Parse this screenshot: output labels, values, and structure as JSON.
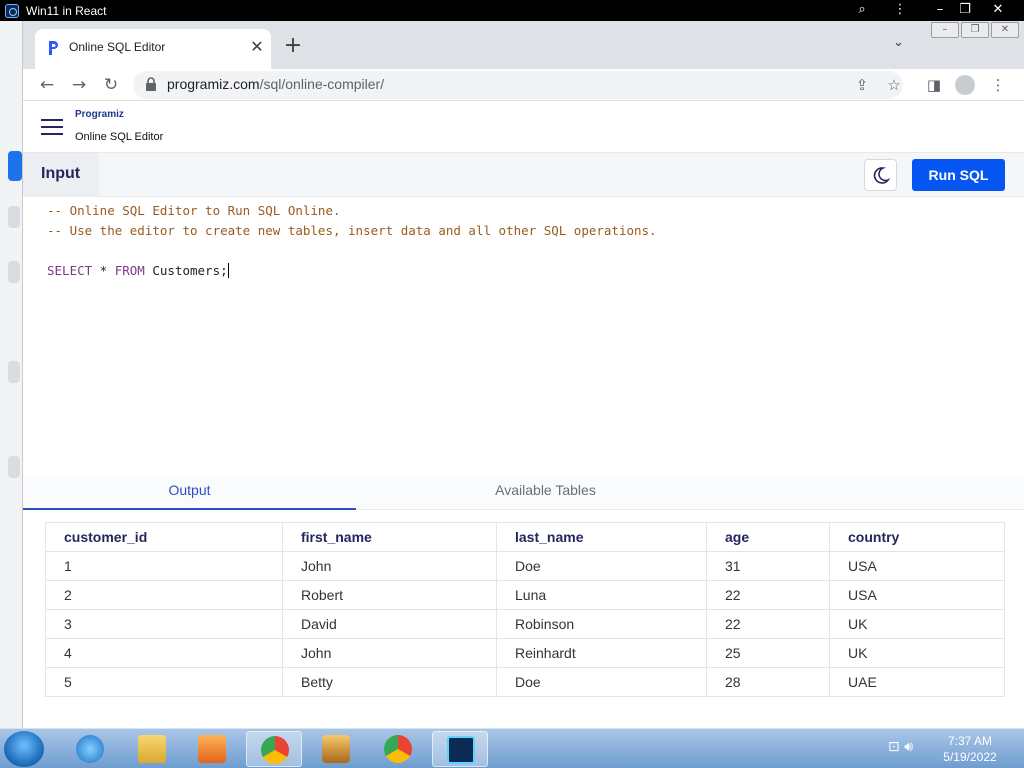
{
  "outer_window": {
    "title": "Win11 in React"
  },
  "chrome": {
    "tab": {
      "title": "Online SQL Editor"
    },
    "address_bar": {
      "host": "programiz.com",
      "path": "/sql/online-compiler/"
    }
  },
  "site": {
    "brand": "Programiz",
    "subtitle": "Online SQL Editor"
  },
  "editor": {
    "input_label": "Input",
    "run_label": "Run SQL",
    "lines": [
      "-- Online SQL Editor to Run SQL Online.",
      "-- Use the editor to create new tables, insert data and all other SQL operations.",
      "",
      "SELECT * FROM Customers;"
    ],
    "query_keyword1": "SELECT",
    "query_star": " * ",
    "query_keyword2": "FROM",
    "query_rest": " Customers;"
  },
  "result_tabs": {
    "output": "Output",
    "tables": "Available Tables"
  },
  "result_table": {
    "columns": [
      "customer_id",
      "first_name",
      "last_name",
      "age",
      "country"
    ],
    "rows": [
      [
        "1",
        "John",
        "Doe",
        "31",
        "USA"
      ],
      [
        "2",
        "Robert",
        "Luna",
        "22",
        "USA"
      ],
      [
        "3",
        "David",
        "Robinson",
        "22",
        "UK"
      ],
      [
        "4",
        "John",
        "Reinhardt",
        "25",
        "UK"
      ],
      [
        "5",
        "Betty",
        "Doe",
        "28",
        "UAE"
      ]
    ]
  },
  "taskbar": {
    "time": "7:37 AM",
    "date": "5/19/2022"
  },
  "colors": {
    "run_button": "#0556f3",
    "active_tab": "#2d4fc4",
    "comment": "#9b5b1e",
    "keyword": "#7a3b84"
  }
}
